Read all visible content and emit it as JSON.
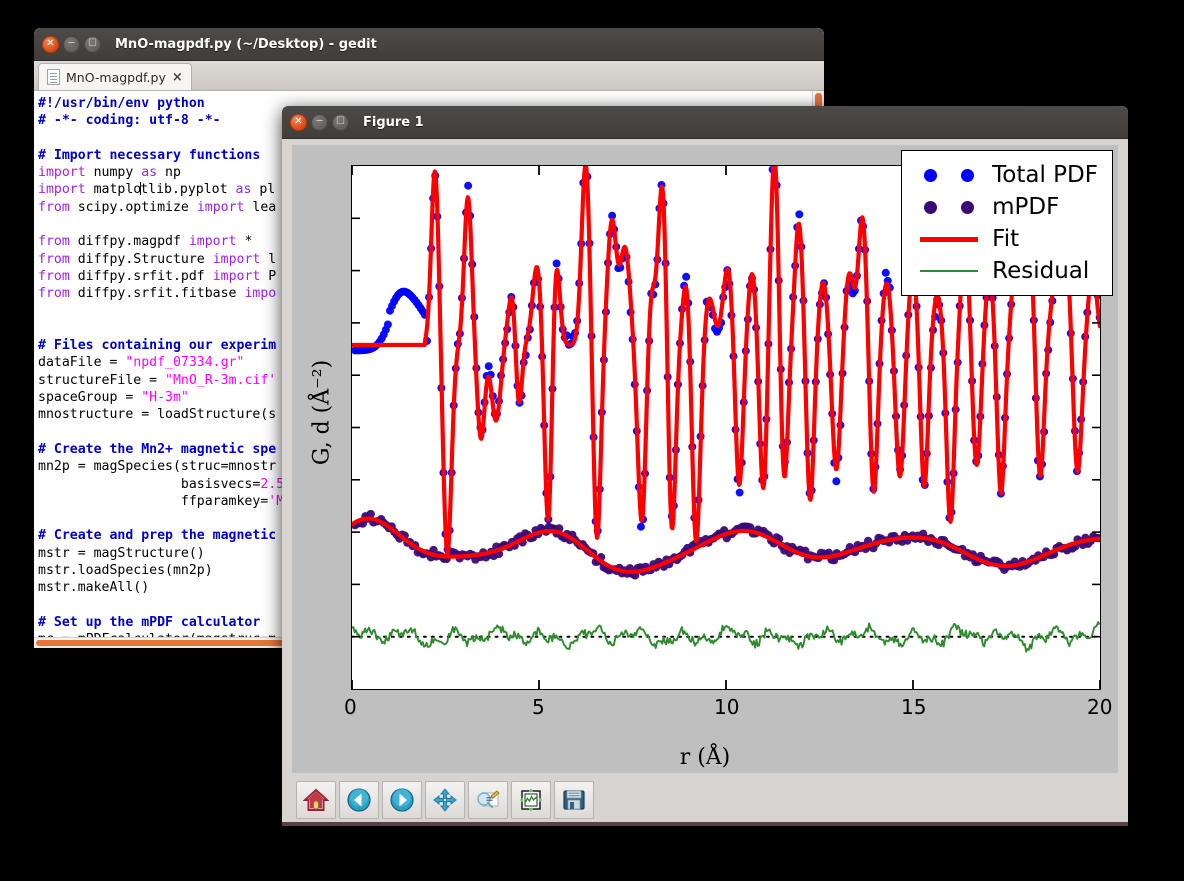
{
  "desktop": {
    "background_color": "#000000"
  },
  "gedit": {
    "window_title": "MnO-magpdf.py (~/Desktop) - gedit",
    "buttons": {
      "close": "close-icon",
      "minimize": "minimize-icon",
      "maximize": "maximize-icon"
    },
    "tab": {
      "label": "MnO-magpdf.py",
      "close_label": "×",
      "icon": "python-file-icon"
    },
    "colors": {
      "comment": "#0000cf",
      "keyword": "#a020f0",
      "string": "#ff00ff",
      "text": "#000000",
      "scrollbar": "#e8743b"
    },
    "code_lines": [
      [
        {
          "t": "#!/usr/bin/env python",
          "c": "c-comment"
        }
      ],
      [
        {
          "t": "# -*- coding: utf-8 -*-",
          "c": "c-comment"
        }
      ],
      [
        {
          "t": "",
          "c": "c-plain"
        }
      ],
      [
        {
          "t": "# Import necessary functions",
          "c": "c-comment"
        }
      ],
      [
        {
          "t": "import",
          "c": "c-kw"
        },
        {
          "t": " numpy ",
          "c": "c-plain"
        },
        {
          "t": "as",
          "c": "c-kw"
        },
        {
          "t": " np",
          "c": "c-plain"
        }
      ],
      [
        {
          "t": "import",
          "c": "c-kw"
        },
        {
          "t": " matplo",
          "c": "c-plain"
        },
        {
          "t": "|",
          "c": "cursor-mark"
        },
        {
          "t": "tlib.pyplot ",
          "c": "c-plain"
        },
        {
          "t": "as",
          "c": "c-kw"
        },
        {
          "t": " pl",
          "c": "c-plain"
        }
      ],
      [
        {
          "t": "from",
          "c": "c-kw"
        },
        {
          "t": " scipy.optimize ",
          "c": "c-plain"
        },
        {
          "t": "import",
          "c": "c-kw"
        },
        {
          "t": " lea",
          "c": "c-plain"
        }
      ],
      [
        {
          "t": "",
          "c": "c-plain"
        }
      ],
      [
        {
          "t": "from",
          "c": "c-kw"
        },
        {
          "t": " diffpy.magpdf ",
          "c": "c-plain"
        },
        {
          "t": "import",
          "c": "c-kw"
        },
        {
          "t": " *",
          "c": "c-plain"
        }
      ],
      [
        {
          "t": "from",
          "c": "c-kw"
        },
        {
          "t": " diffpy.Structure ",
          "c": "c-plain"
        },
        {
          "t": "import",
          "c": "c-kw"
        },
        {
          "t": " l",
          "c": "c-plain"
        }
      ],
      [
        {
          "t": "from",
          "c": "c-kw"
        },
        {
          "t": " diffpy.srfit.pdf ",
          "c": "c-plain"
        },
        {
          "t": "import",
          "c": "c-kw"
        },
        {
          "t": " P",
          "c": "c-plain"
        }
      ],
      [
        {
          "t": "from",
          "c": "c-kw"
        },
        {
          "t": " diffpy.srfit.fitbase ",
          "c": "c-plain"
        },
        {
          "t": "impo",
          "c": "c-kw"
        }
      ],
      [
        {
          "t": "",
          "c": "c-plain"
        }
      ],
      [
        {
          "t": "",
          "c": "c-plain"
        }
      ],
      [
        {
          "t": "# Files containing our experim",
          "c": "c-comment"
        }
      ],
      [
        {
          "t": "dataFile = ",
          "c": "c-plain"
        },
        {
          "t": "\"npdf_07334.gr\"",
          "c": "c-str"
        }
      ],
      [
        {
          "t": "structureFile = ",
          "c": "c-plain"
        },
        {
          "t": "\"MnO_R-3m.cif'",
          "c": "c-str"
        }
      ],
      [
        {
          "t": "spaceGroup = ",
          "c": "c-plain"
        },
        {
          "t": "\"H-3m\"",
          "c": "c-str"
        }
      ],
      [
        {
          "t": "mnostructure = loadStructure(s",
          "c": "c-plain"
        }
      ],
      [
        {
          "t": "",
          "c": "c-plain"
        }
      ],
      [
        {
          "t": "# Create the Mn2+ magnetic spe",
          "c": "c-comment"
        }
      ],
      [
        {
          "t": "mn2p = magSpecies(struc=mnostr",
          "c": "c-plain"
        }
      ],
      [
        {
          "t": "                  basisvecs=",
          "c": "c-plain"
        },
        {
          "t": "2.5",
          "c": "c-num"
        }
      ],
      [
        {
          "t": "                  ffparamkey=",
          "c": "c-plain"
        },
        {
          "t": "'M",
          "c": "c-str"
        }
      ],
      [
        {
          "t": "",
          "c": "c-plain"
        }
      ],
      [
        {
          "t": "# Create and prep the magnetic",
          "c": "c-comment"
        }
      ],
      [
        {
          "t": "mstr = magStructure()",
          "c": "c-plain"
        }
      ],
      [
        {
          "t": "mstr.loadSpecies(mn2p)",
          "c": "c-plain"
        }
      ],
      [
        {
          "t": "mstr.makeAll()",
          "c": "c-plain"
        }
      ],
      [
        {
          "t": "",
          "c": "c-plain"
        }
      ],
      [
        {
          "t": "# Set up the mPDF calculator",
          "c": "c-comment"
        }
      ],
      [
        {
          "t": "mc = mPDFcalculator(magstruc=m",
          "c": "c-plain"
        }
      ]
    ]
  },
  "figure": {
    "window_title": "Figure 1",
    "buttons": {
      "close": "close-icon",
      "minimize": "minimize-icon",
      "maximize": "maximize-icon"
    },
    "toolbar": [
      {
        "name": "home-button",
        "tooltip": "Home"
      },
      {
        "name": "back-button",
        "tooltip": "Back"
      },
      {
        "name": "forward-button",
        "tooltip": "Forward"
      },
      {
        "name": "pan-button",
        "tooltip": "Pan"
      },
      {
        "name": "zoom-rect-button",
        "tooltip": "Zoom to rectangle"
      },
      {
        "name": "configure-subplots-button",
        "tooltip": "Configure subplots"
      },
      {
        "name": "save-button",
        "tooltip": "Save the figure"
      }
    ]
  },
  "chart_data": {
    "type": "line",
    "title": "",
    "xlabel": "r (Å)",
    "ylabel": "G, d (Å⁻²)",
    "xlim": [
      0,
      20
    ],
    "xticks": [
      0,
      5,
      10,
      15,
      20
    ],
    "xticklabels": [
      "0",
      "5",
      "10",
      "15",
      "20"
    ],
    "ylim": [
      -9.5,
      9.5
    ],
    "yticks": [],
    "yticklabels": [],
    "grid": false,
    "legend_position": "upper right",
    "legend": [
      {
        "label": "Total PDF",
        "style": "markers",
        "color": "#0000ff",
        "marker": "circle"
      },
      {
        "label": "mPDF",
        "style": "markers",
        "color": "#3c0a78",
        "marker": "circle"
      },
      {
        "label": "Fit",
        "style": "line",
        "color": "#ff0000",
        "linewidth": 3
      },
      {
        "label": "Residual",
        "style": "line",
        "color": "#2e8b2e",
        "linewidth": 1.5
      }
    ],
    "annotations": [
      {
        "text": "dotted zero line for residual",
        "color": "#000000",
        "style": "dotted"
      }
    ],
    "series": [
      {
        "name": "Total PDF",
        "color": "#0000ff",
        "offset": 3.0,
        "description": "Neutron total PDF of MnO with sharp oscillating Bragg-like peaks from r=1 to r=20 Angstrom; amplitude decays slowly; peaks near r = 2.2, 3.1, 4.4, 5.2, 6.3, 7.3, 8.3, 9.2, 10.1, 11.3, 12.1, 13.8, 15.5, 16.5, 18.2, 19.3"
      },
      {
        "name": "mPDF",
        "color": "#3c0a78",
        "offset": -4.4,
        "description": "Magnetic PDF, broad slow oscillation with period ~5 Angstrom, amplitude ~0.6, offset below the total PDF"
      },
      {
        "name": "Fit",
        "color": "#ff0000",
        "description": "Red calculated fit curve overlaying both the total PDF and the mPDF datasets"
      },
      {
        "name": "Residual",
        "color": "#2e8b2e",
        "offset": -7.6,
        "description": "Green noise-level difference curve near zero, plotted at the bottom with a dotted zero baseline"
      }
    ]
  }
}
